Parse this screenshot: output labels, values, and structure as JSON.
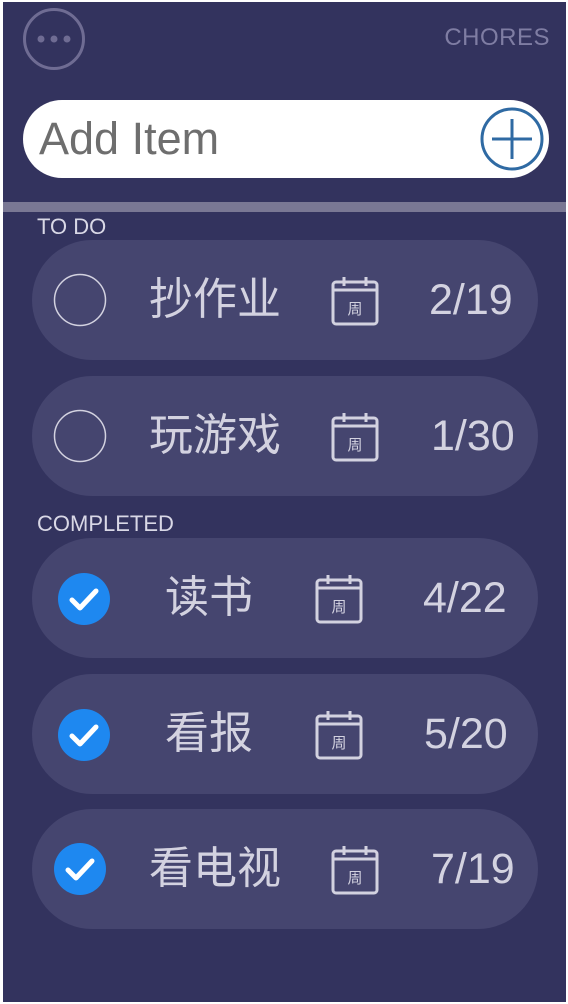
{
  "header": {
    "title": "CHORES",
    "menu_icon": "more-horizontal-icon"
  },
  "add_item": {
    "placeholder": "Add Item",
    "add_icon": "plus-circle-icon"
  },
  "todo": {
    "label": "TO DO",
    "items": [
      {
        "text": "抄作业",
        "date": "2/19",
        "done": false,
        "calendar_char": "周"
      },
      {
        "text": "玩游戏",
        "date": "1/30",
        "done": false,
        "calendar_char": "周"
      }
    ]
  },
  "completed": {
    "label": "COMPLETED",
    "items": [
      {
        "text": "读书",
        "date": "4/22",
        "done": true,
        "calendar_char": "周"
      },
      {
        "text": "看报",
        "date": "5/20",
        "done": true,
        "calendar_char": "周"
      },
      {
        "text": "看电视",
        "date": "7/19",
        "done": true,
        "calendar_char": "周"
      }
    ]
  },
  "colors": {
    "background": "#33335e",
    "card": "#45456f",
    "text": "#d3d2e0",
    "check_blue": "#1e88f0",
    "add_button_blue": "#2f6aa3"
  }
}
